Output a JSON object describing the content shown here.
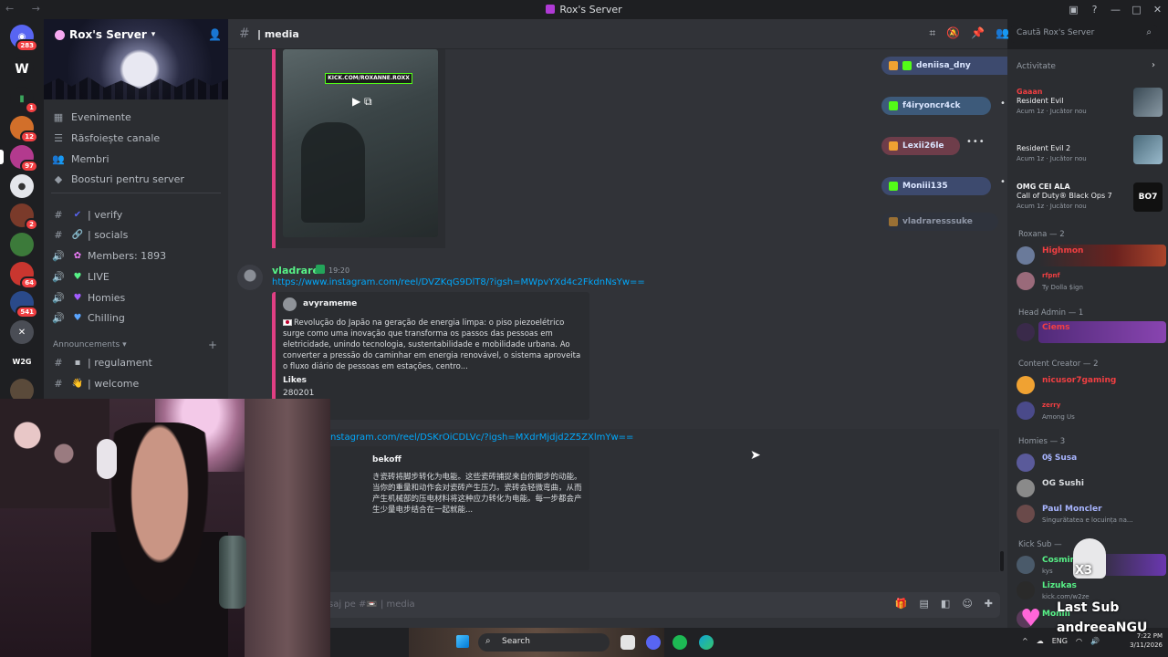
{
  "window": {
    "title": "Rox's Server"
  },
  "server": {
    "name": "Rox's Server",
    "chevron": "▾"
  },
  "rail": {
    "badges": [
      "283",
      "1",
      "12",
      "97",
      "2",
      "64",
      "541"
    ]
  },
  "sidebar": {
    "top_items": [
      {
        "icon": "calendar-icon",
        "label": "Evenimente"
      },
      {
        "icon": "browse-icon",
        "label": "Răsfoiește canale"
      },
      {
        "icon": "members-icon",
        "label": "Membri"
      },
      {
        "icon": "boost-icon",
        "label": "Boosturi pentru server"
      }
    ],
    "channels": [
      {
        "type": "#",
        "emoji": "✔",
        "label": "| verify"
      },
      {
        "type": "#",
        "emoji": "🔗",
        "label": "| socials"
      },
      {
        "type": "🔊",
        "emoji": "✿",
        "label": "Members: 1893"
      },
      {
        "type": "🔊",
        "emoji": "♥",
        "label": "LIVE"
      },
      {
        "type": "🔊",
        "emoji": "♥",
        "label": "Homies"
      },
      {
        "type": "🔊",
        "emoji": "♥",
        "label": "Chilling"
      }
    ],
    "category": "Announcements",
    "ann_channels": [
      {
        "type": "#",
        "emoji": "▪",
        "label": "| regulament"
      },
      {
        "type": "#",
        "emoji": "👋",
        "label": "| welcome"
      }
    ]
  },
  "chat": {
    "channel_name": "| media",
    "search_placeholder": "Caută Rox's Server",
    "video_overlay": "KICK.COM/ROXANNE.ROXX",
    "message": {
      "author": "vladrares",
      "time": "19:20",
      "link": "https://www.instagram.com/reel/DVZKqG9DlT8/?igsh=MWpvYXd4c2FkdnNsYw==",
      "embed": {
        "author": "avyrameme",
        "description": "Revolução do Japão na geração de energia limpa: o piso piezoelétrico surge como uma inovação que transforma os passos das pessoas em eletricidade, unindo tecnologia, sustentabilidade e mobilidade urbana. Ao converter a pressão do caminhar em energia renovável, o sistema aproveita o fluxo diário de pessoas em estações, centro...",
        "field_name": "Likes",
        "field_value": "280201"
      }
    },
    "message2": {
      "link": "nstagram.com/reel/DSKrOiCDLVc/?igsh=MXdrMjdjd2Z5ZXlmYw==",
      "embed": {
        "author": "bekoff",
        "description": "き瓷砖将脚步转化为电能。这些瓷砖捕捉来自你脚步的动能。当你的重量和动作会对瓷砖产生压力。瓷砖会轻微弯曲，从而产生机械部的压电材料将这种应力转化为电能。每一步都会产生少量电步结合在一起就能..."
      }
    },
    "composer_placeholder": "saj pe #📼 | media"
  },
  "voice": {
    "users": [
      "deniisa_dny",
      "f4iryoncr4ck",
      "Lexii26le",
      "Moniii135",
      "vladraresssuke"
    ],
    "label": "OMG CEI ALA"
  },
  "members": {
    "activity_header": "Activitate",
    "activities": [
      {
        "name": "Gaaan",
        "game": "Resident Evil",
        "sub": "Acum 1z · Jucător nou"
      },
      {
        "name": "",
        "game": "Resident Evil 2",
        "sub": "Acum 1z · Jucător nou"
      },
      {
        "name": "",
        "game": "Call of Duty® Black Ops 7",
        "sub": "Acum 1z · Jucător nou"
      }
    ],
    "groups": [
      {
        "title": "Roxana — 2",
        "items": [
          {
            "name": "Highmon",
            "status": "",
            "color": "#f23f42"
          },
          {
            "name": "rfpnf",
            "status": "Ty Dolla $ign",
            "color": "#f23f42"
          }
        ]
      },
      {
        "title": "Head Admin — 1",
        "items": [
          {
            "name": "Ciems",
            "status": "",
            "color": "#f23f42"
          }
        ]
      },
      {
        "title": "Content Creator — 2",
        "items": [
          {
            "name": "nicusor7gaming",
            "status": "",
            "color": "#f23f42"
          },
          {
            "name": "zerry",
            "status": "Among Us",
            "color": "#f23f42"
          }
        ]
      },
      {
        "title": "Homies — 3",
        "items": [
          {
            "name": "0§ Susa",
            "status": "",
            "color": "#a8b5ff"
          },
          {
            "name": "OG Sushi",
            "status": "",
            "color": "#dbdee1"
          },
          {
            "name": "Paul Moncler",
            "status": "Singurătatea e locuința na...",
            "color": "#a8b5ff"
          }
        ]
      },
      {
        "title": "Kick Sub — ",
        "items": [
          {
            "name": "Cosmin",
            "status": "kys",
            "color": "#57f287"
          },
          {
            "name": "Lizukas",
            "status": "kick.com/w2ze",
            "color": "#57f287"
          },
          {
            "name": "Moniii",
            "status": "",
            "color": "#57f287"
          }
        ]
      }
    ]
  },
  "overlay": {
    "last_sub_label": "Last Sub",
    "last_sub_name": "andreeaNGU",
    "ghost_count": "X3"
  },
  "taskbar": {
    "search_label": "Search",
    "lang": "ENG",
    "time": "7:22 PM",
    "date": "3/11/2026"
  },
  "colors": {
    "accent": "#5865f2",
    "link": "#00a8fc",
    "embed_bar": "#e03f83",
    "kick_green": "#53fc18"
  }
}
